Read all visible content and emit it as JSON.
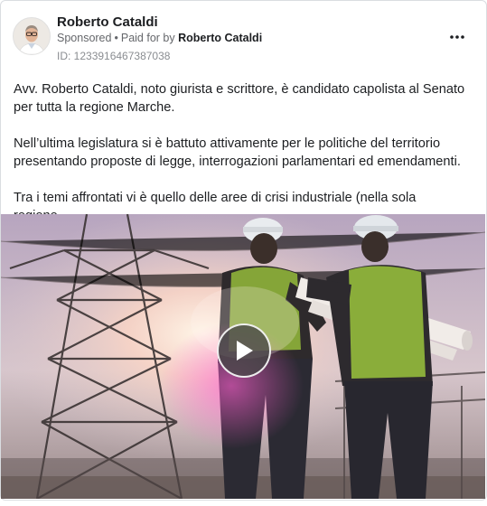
{
  "post": {
    "author_name": "Roberto Cataldi",
    "sponsored_label": "Sponsored",
    "separator": "•",
    "paid_for_prefix": "Paid for by",
    "paid_for_name": "Roberto Cataldi",
    "ad_id": "ID: 1233916467387038",
    "paragraphs": [
      "Avv. Roberto Cataldi, noto giurista e scrittore, è candidato capolista al Senato per tutta la regione Marche.",
      "Nell’ultima legislatura si è battuto attivamente per le politiche del territorio presentando proposte di legge, interrogazioni parlamentari ed emendamenti.",
      "Tra i temi affrontati vi è quello delle aree di crisi industriale (nella sola regione…"
    ]
  },
  "icons": {
    "more": "more-options-icon",
    "play": "play-icon"
  },
  "colors": {
    "name_text": "#1c1e21",
    "meta_text": "#65676b",
    "id_text": "#8a8d91",
    "border": "#dadde1"
  }
}
